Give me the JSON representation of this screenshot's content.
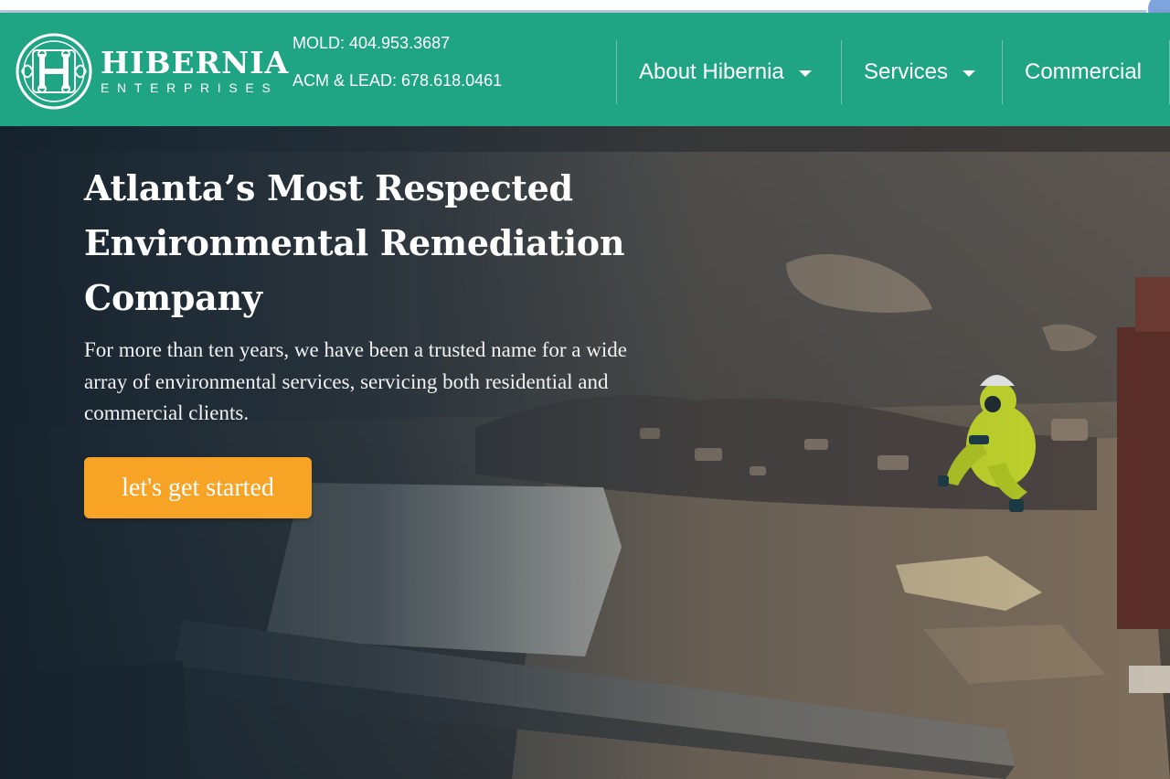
{
  "brand": {
    "name": "HIBERNIA",
    "subtitle": "ENTERPRISES"
  },
  "contacts": {
    "mold": "MOLD: 404.953.3687",
    "acm_lead": "ACM & LEAD: 678.618.0461"
  },
  "nav": {
    "items": [
      {
        "label": "About Hibernia",
        "has_dropdown": true
      },
      {
        "label": "Services",
        "has_dropdown": true
      },
      {
        "label": "Commercial",
        "has_dropdown": false
      }
    ]
  },
  "hero": {
    "title_lines": [
      "Atlanta’s Most Respected",
      "Environmental Remediation",
      "Company"
    ],
    "description": "For more than ten years, we have been a trusted name for a wide array of environmental services, servicing both residential and commercial clients.",
    "cta_label": "let's get started"
  },
  "colors": {
    "header_bg": "#1fa583",
    "cta_bg": "#f7a325",
    "hazmat_suit": "#c8dc2a"
  }
}
